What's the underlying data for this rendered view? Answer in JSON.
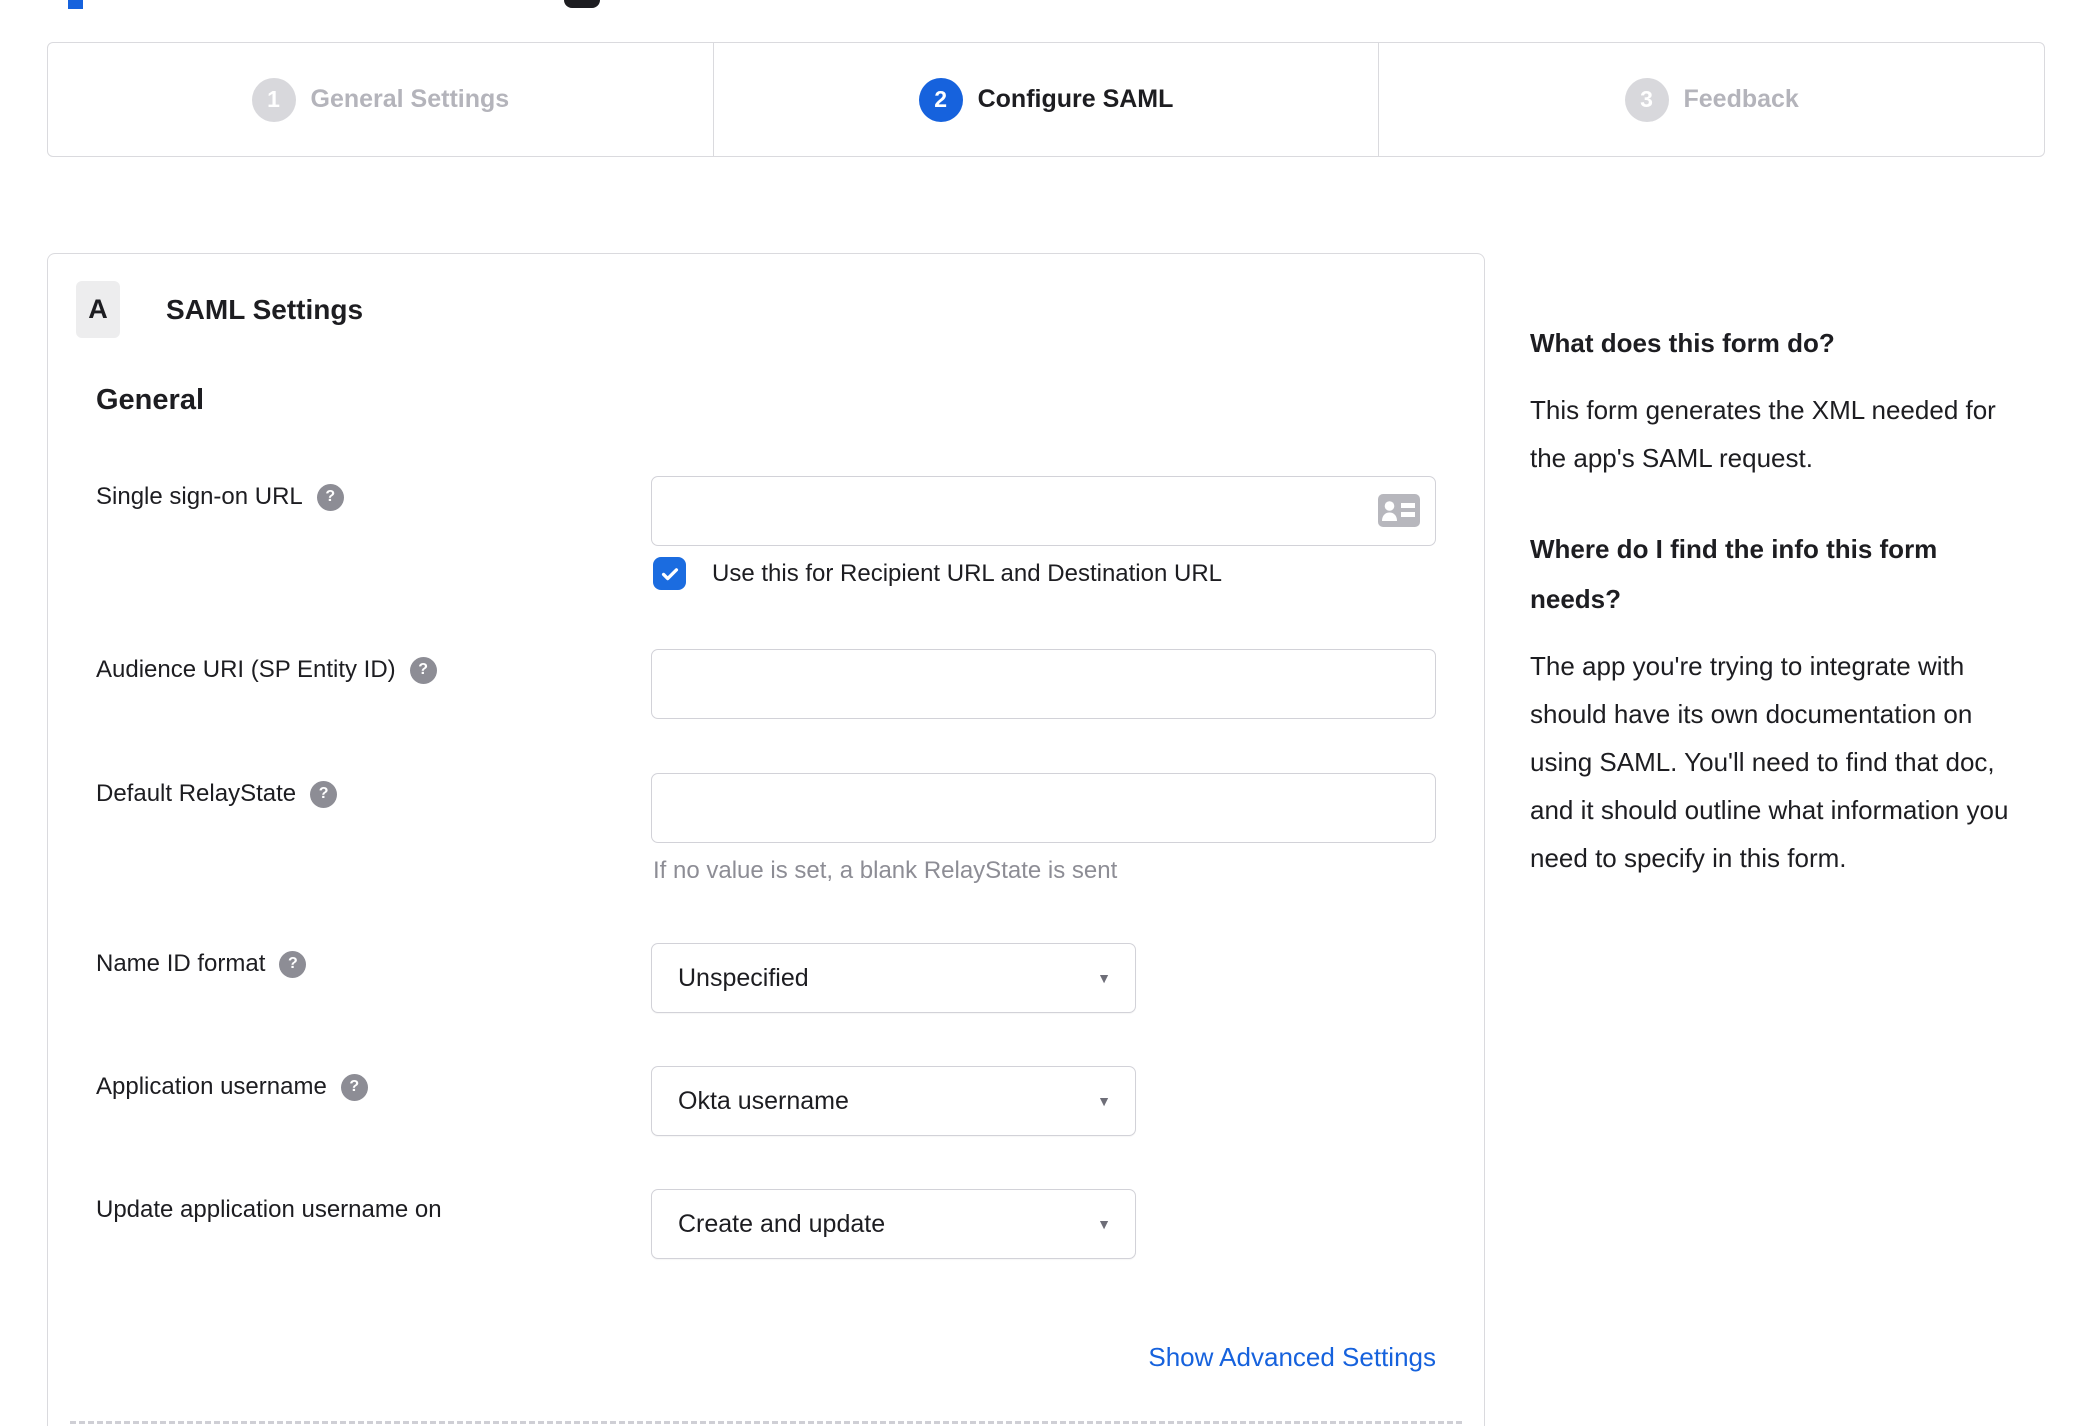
{
  "stepper": {
    "steps": [
      {
        "number": "1",
        "label": "General Settings",
        "state": "inactive"
      },
      {
        "number": "2",
        "label": "Configure SAML",
        "state": "active"
      },
      {
        "number": "3",
        "label": "Feedback",
        "state": "inactive"
      }
    ]
  },
  "form": {
    "section_badge": "A",
    "section_title": "SAML Settings",
    "group_title": "General",
    "fields": [
      {
        "label": "Single sign-on URL",
        "value": "",
        "checkbox_label": "Use this for Recipient URL and Destination URL",
        "checkbox_checked": true
      },
      {
        "label": "Audience URI (SP Entity ID)",
        "value": ""
      },
      {
        "label": "Default RelayState",
        "value": "",
        "hint": "If no value is set, a blank RelayState is sent"
      },
      {
        "label": "Name ID format",
        "value": "Unspecified"
      },
      {
        "label": "Application username",
        "value": "Okta username"
      },
      {
        "label": "Update application username on",
        "value": "Create and update"
      }
    ],
    "advanced_link": "Show Advanced Settings"
  },
  "help_panel": {
    "sections": [
      {
        "title": "What does this form do?",
        "body": "This form generates the XML needed for the app's SAML request."
      },
      {
        "title": "Where do I find the info this form needs?",
        "body": "The app you're trying to integrate with should have its own documentation on using SAML. You'll need to find that doc, and it should outline what information you need to specify in this form."
      }
    ]
  },
  "colors": {
    "accent_blue": "#1662dd",
    "inactive_gray": "#d8d8dc",
    "text_dark": "#1d1d21",
    "text_gray": "#8d8d95"
  }
}
